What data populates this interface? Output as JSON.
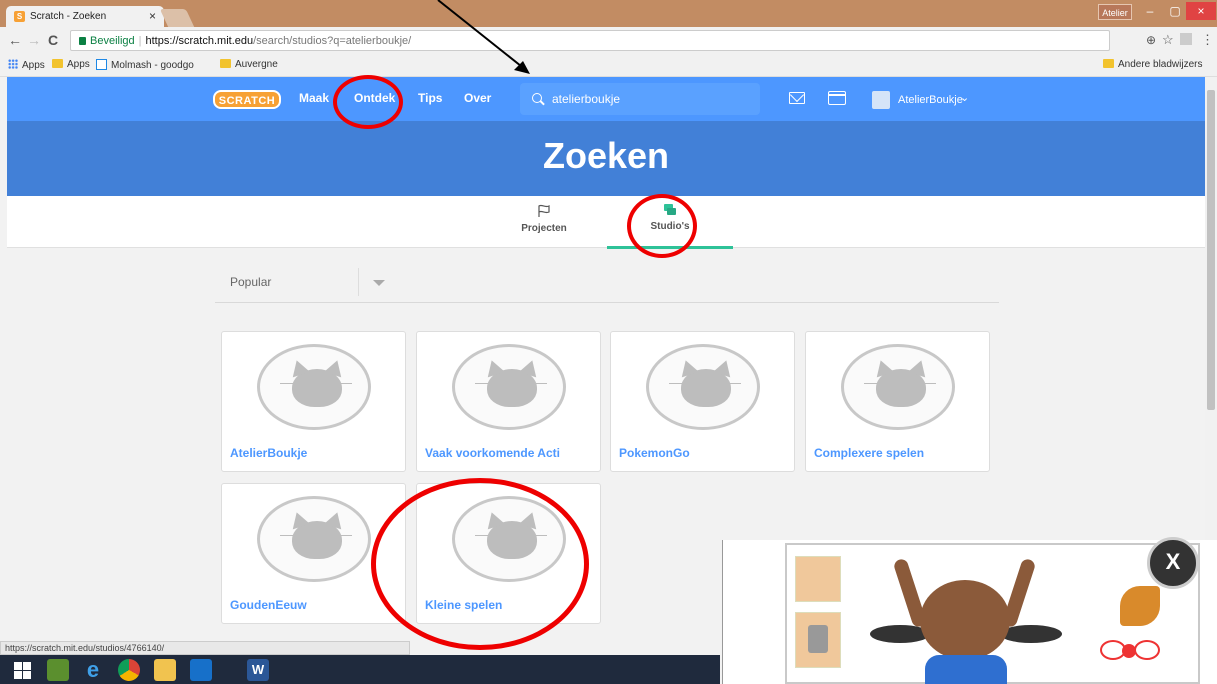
{
  "browser": {
    "tab_title": "Scratch - Zoeken",
    "tab_favicon": "S",
    "tab_close": "×",
    "profile_label": "Atelier",
    "win_min": "–",
    "win_max": "▢",
    "win_close": "×",
    "nav_back": "←",
    "nav_forward": "→",
    "nav_reload": "C",
    "security_label": "Beveiligd",
    "url_host": "https://scratch.mit.edu",
    "url_path": "/search/studios?q=atelierboukje/",
    "zoom_icon": "⊕",
    "star_icon": "☆",
    "menu_icon": "⋮",
    "bookmarks": [
      "Apps",
      "Apps",
      "Molmash - goodgo",
      "Auvergne"
    ],
    "other_bookmarks": "Andere bladwijzers",
    "status_url": "https://scratch.mit.edu/studios/4766140/"
  },
  "scratch_nav": {
    "logo": "SCRATCH",
    "items": [
      "Maak",
      "Ontdek",
      "Tips",
      "Over"
    ],
    "search_value": "atelierboukje",
    "username": "AtelierBoukje",
    "chevron": "⌄"
  },
  "page": {
    "title": "Zoeken",
    "tabs": [
      "Projecten",
      "Studio's"
    ],
    "active_tab": "Studio's",
    "sort_label": "Popular"
  },
  "studios": [
    {
      "title": "AtelierBoukje"
    },
    {
      "title": "Vaak voorkomende Acti"
    },
    {
      "title": "PokemonGo"
    },
    {
      "title": "Complexere spelen"
    },
    {
      "title": "GoudenEeuw"
    },
    {
      "title": "Kleine spelen"
    }
  ],
  "video_overlay": {
    "close_label": "X"
  },
  "colors": {
    "scratch_blue": "#4d97ff",
    "hero_blue": "#4280d7",
    "studio_green": "#2ec298",
    "annotation_red": "#e00000"
  }
}
